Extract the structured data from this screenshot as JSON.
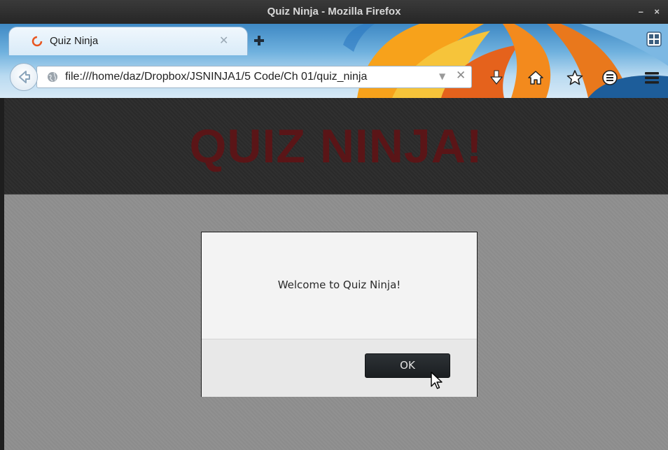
{
  "window": {
    "title": "Quiz Ninja - Mozilla Firefox",
    "controls": "– ×"
  },
  "tab": {
    "title": "Quiz Ninja",
    "close_icon": "close-icon",
    "favicon": "firefox-loading-icon"
  },
  "navbar": {
    "url": "file:///home/daz/Dropbox/JSNINJA1/5 Code/Ch 01/quiz_ninja",
    "icons": [
      "back-arrow-icon",
      "globe-icon",
      "dropdown-icon",
      "clear-icon",
      "download-icon",
      "home-icon",
      "bookmark-star-icon",
      "reading-list-icon",
      "menu-icon",
      "grid-icon",
      "new-tab-icon"
    ]
  },
  "page": {
    "title": "QUIZ NINJA!",
    "title_color": "#5a1517"
  },
  "dialog": {
    "message": "Welcome to Quiz Ninja!",
    "ok_label": "OK"
  }
}
